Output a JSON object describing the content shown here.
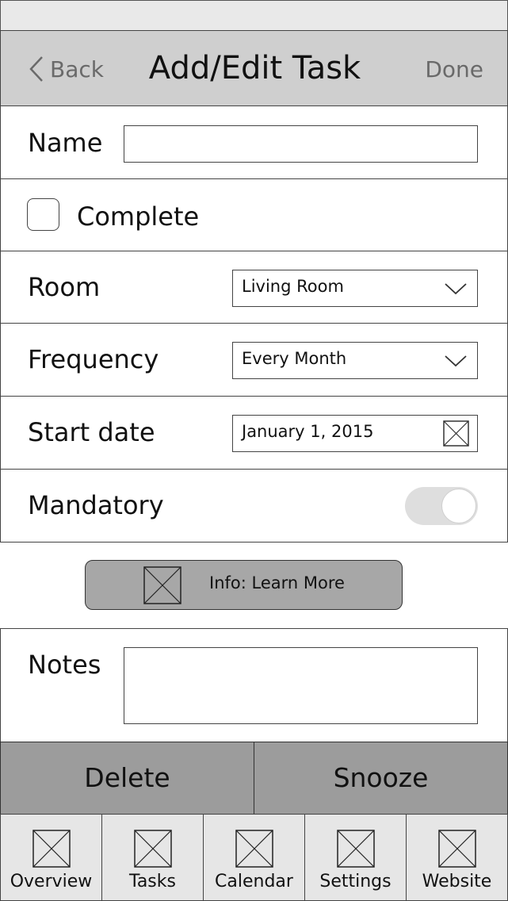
{
  "nav": {
    "back_label": "Back",
    "title": "Add/Edit Task",
    "done_label": "Done"
  },
  "form": {
    "name": {
      "label": "Name",
      "value": ""
    },
    "complete": {
      "label": "Complete",
      "checked": false
    },
    "room": {
      "label": "Room",
      "value": "Living Room"
    },
    "frequency": {
      "label": "Frequency",
      "value": "Every Month"
    },
    "start_date": {
      "label": "Start date",
      "value": "January 1, 2015"
    },
    "mandatory": {
      "label": "Mandatory",
      "on": false
    },
    "notes": {
      "label": "Notes",
      "value": ""
    }
  },
  "info_button": {
    "label": "Info: Learn More",
    "icon": "image-placeholder-icon"
  },
  "actions": {
    "delete_label": "Delete",
    "snooze_label": "Snooze"
  },
  "tabs": [
    {
      "label": "Overview",
      "icon": "image-placeholder-icon"
    },
    {
      "label": "Tasks",
      "icon": "image-placeholder-icon"
    },
    {
      "label": "Calendar",
      "icon": "image-placeholder-icon"
    },
    {
      "label": "Settings",
      "icon": "image-placeholder-icon"
    },
    {
      "label": "Website",
      "icon": "image-placeholder-icon"
    }
  ],
  "colors": {
    "nav_bar": "#cfcfcf",
    "status_bar": "#e9e9e9",
    "action_buttons": "#9c9c9c",
    "info_button": "#a7a7a7",
    "tab_bar": "#e6e6e6",
    "muted_text": "#6a6a6a"
  }
}
